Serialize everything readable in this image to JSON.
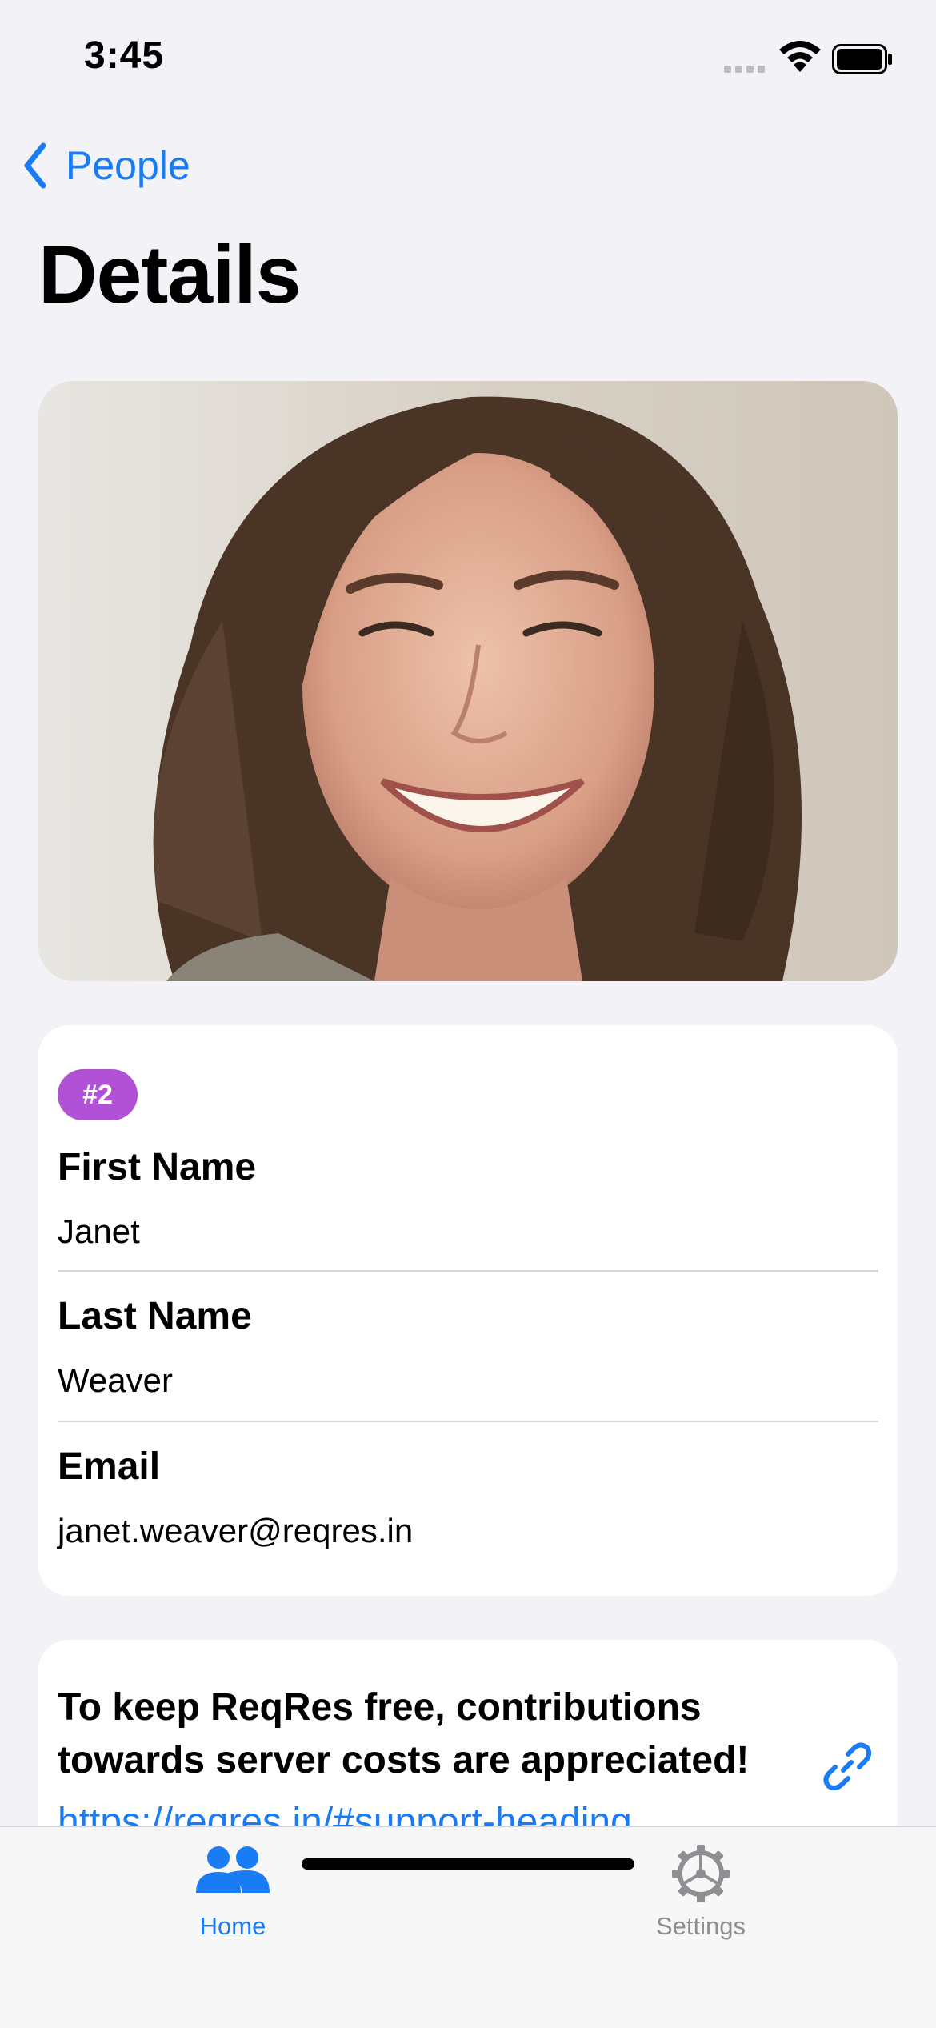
{
  "status_bar": {
    "time": "3:45"
  },
  "nav": {
    "back_label": "People",
    "title": "Details"
  },
  "user": {
    "id_badge": "#2",
    "fields": [
      {
        "label": "First Name",
        "value": "Janet"
      },
      {
        "label": "Last Name",
        "value": "Weaver"
      },
      {
        "label": "Email",
        "value": "janet.weaver@reqres.in"
      }
    ]
  },
  "support": {
    "text": "To keep ReqRes free, contributions towards server costs are appreciated!",
    "link": "https://reqres.in/#support-heading"
  },
  "tab_bar": {
    "tabs": [
      {
        "label": "Home",
        "icon": "people-icon",
        "selected": true
      },
      {
        "label": "Settings",
        "icon": "gear-icon",
        "selected": false
      }
    ]
  },
  "colors": {
    "accent": "#1a7cf5",
    "badge": "#b152d6",
    "background": "#f2f2f7"
  }
}
